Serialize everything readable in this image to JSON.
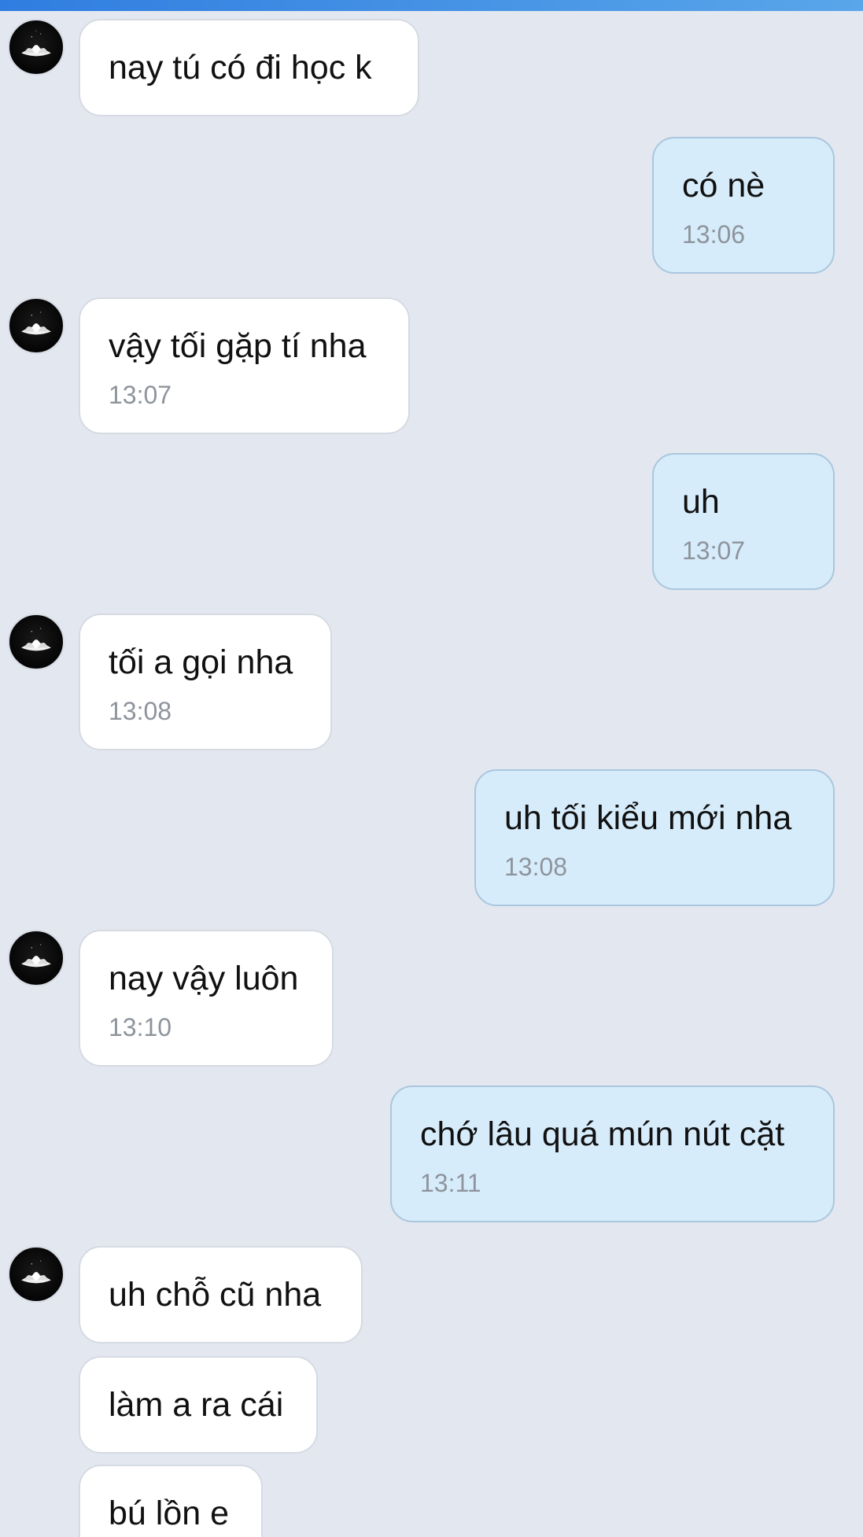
{
  "chat": {
    "messages": [
      {
        "side": "in",
        "text": "nay tú có đi học k",
        "time": ""
      },
      {
        "side": "out",
        "text": "có nè",
        "time": "13:06"
      },
      {
        "side": "in",
        "text": "vậy tối gặp tí nha",
        "time": "13:07"
      },
      {
        "side": "out",
        "text": "uh",
        "time": "13:07"
      },
      {
        "side": "in",
        "text": "tối a gọi nha",
        "time": "13:08"
      },
      {
        "side": "out",
        "text": "uh tối kiểu mới nha",
        "time": "13:08"
      },
      {
        "side": "in",
        "text": "nay vậy luôn",
        "time": "13:10"
      },
      {
        "side": "out",
        "text": "chớ lâu quá mún nút cặt",
        "time": "13:11"
      },
      {
        "side": "in",
        "text": "uh chỗ cũ nha",
        "time": ""
      },
      {
        "side": "in",
        "text": "làm a ra cái",
        "time": ""
      },
      {
        "side": "in",
        "text": "bú lồn e",
        "time": ""
      }
    ]
  }
}
